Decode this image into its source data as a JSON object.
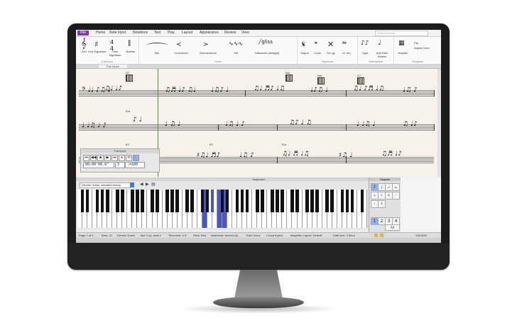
{
  "app": {
    "file_tab": "File",
    "tabs": [
      "Home",
      "Note Input",
      "Notations",
      "Text",
      "Play",
      "Layout",
      "Appearance",
      "Review",
      "View"
    ],
    "search_placeholder": "Find in ribbon"
  },
  "ribbon": {
    "common": {
      "label": "Common",
      "clef": "Clef",
      "key": "Key Signature",
      "time": "Time Signature",
      "barline": "Barline"
    },
    "lines": {
      "label": "Lines",
      "items": [
        "Slur",
        "Crescendo",
        "Decrescendo",
        "Trill",
        "Glissando (straight)"
      ]
    },
    "symbols": {
      "label": "Symbols",
      "items": [
        "Segno",
        "Coda",
        "Da..gy",
        "In..ers"
      ]
    },
    "noteheads": {
      "label": "Noteheads",
      "items": [
        "Type",
        "Add Note Names"
      ]
    },
    "graphics": {
      "label": "Graphics",
      "items": [
        "Graphic",
        "Flip",
        "Adjust Color"
      ]
    }
  },
  "score": {
    "tab_label": "Full Score",
    "chord_symbols": [
      "G7",
      "Am",
      "Dm",
      "C7",
      "Em",
      "A7",
      "D7",
      "Fm"
    ]
  },
  "transport": {
    "title": "Transport",
    "timecode": "00:00'06.0\"",
    "bar": "3",
    "tempo": "♩=100",
    "buttons": [
      "⏮",
      "◀◀",
      "■",
      "▶",
      "⏭",
      "●",
      "⟲",
      "♩"
    ]
  },
  "keyboard": {
    "title": "Keyboard",
    "instrument": "Electric Guitar, standard tuning"
  },
  "keypad": {
    "title": "Keypad",
    "keys": [
      "♪",
      "♩",
      "𝅗𝅥",
      "𝅝",
      "♭",
      "♮",
      "♯",
      "·",
      "𝄾",
      "𝄽",
      "1",
      "2",
      "3",
      "4",
      "All"
    ]
  },
  "status": {
    "page": "Page 1 of 5",
    "bars": "Bars: 21",
    "instrument": "Electric Guitar",
    "bar_pos": "Bar 3 (4), beat 2",
    "timecode": "Timecode: 6.0\"",
    "pitch": "Pitch: Bb4",
    "notehead": "Notehead: Normal (0)",
    "mode": "Edit Chord",
    "concert": "Concert pitch",
    "layout": "Magnetic Layout: Default",
    "staff": "Staff size: 3.5mm",
    "zoom": "106.60%"
  }
}
